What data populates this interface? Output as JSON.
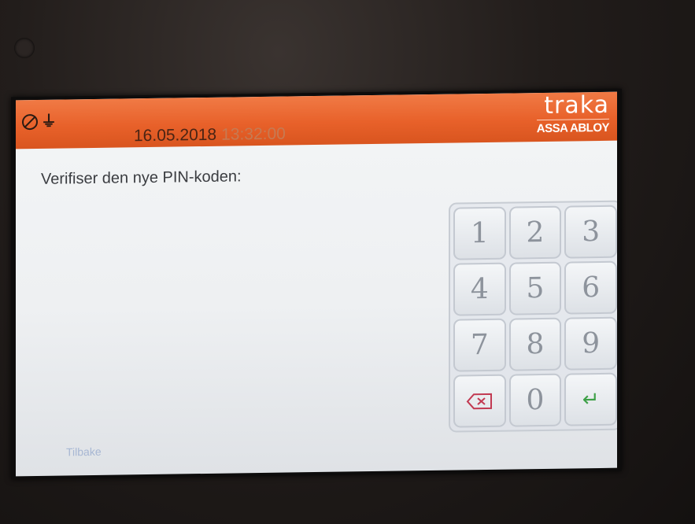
{
  "header": {
    "date": "16.05.2018",
    "time": "13:32:00",
    "brand_logo": "traka",
    "brand_sub": "ASSA ABLOY",
    "status_icons": [
      "no-entry-icon",
      "plug-icon"
    ],
    "accent_color": "#e8612a"
  },
  "prompt": "Verifiser den nye PIN-koden:",
  "keypad": {
    "keys": [
      "1",
      "2",
      "3",
      "4",
      "5",
      "6",
      "7",
      "8",
      "9",
      "0"
    ],
    "backspace_icon": "backspace-icon",
    "enter_icon": "enter-icon",
    "backspace_color": "#c23a52",
    "enter_color": "#3ea048"
  },
  "footer": {
    "back_label": "Tilbake"
  }
}
